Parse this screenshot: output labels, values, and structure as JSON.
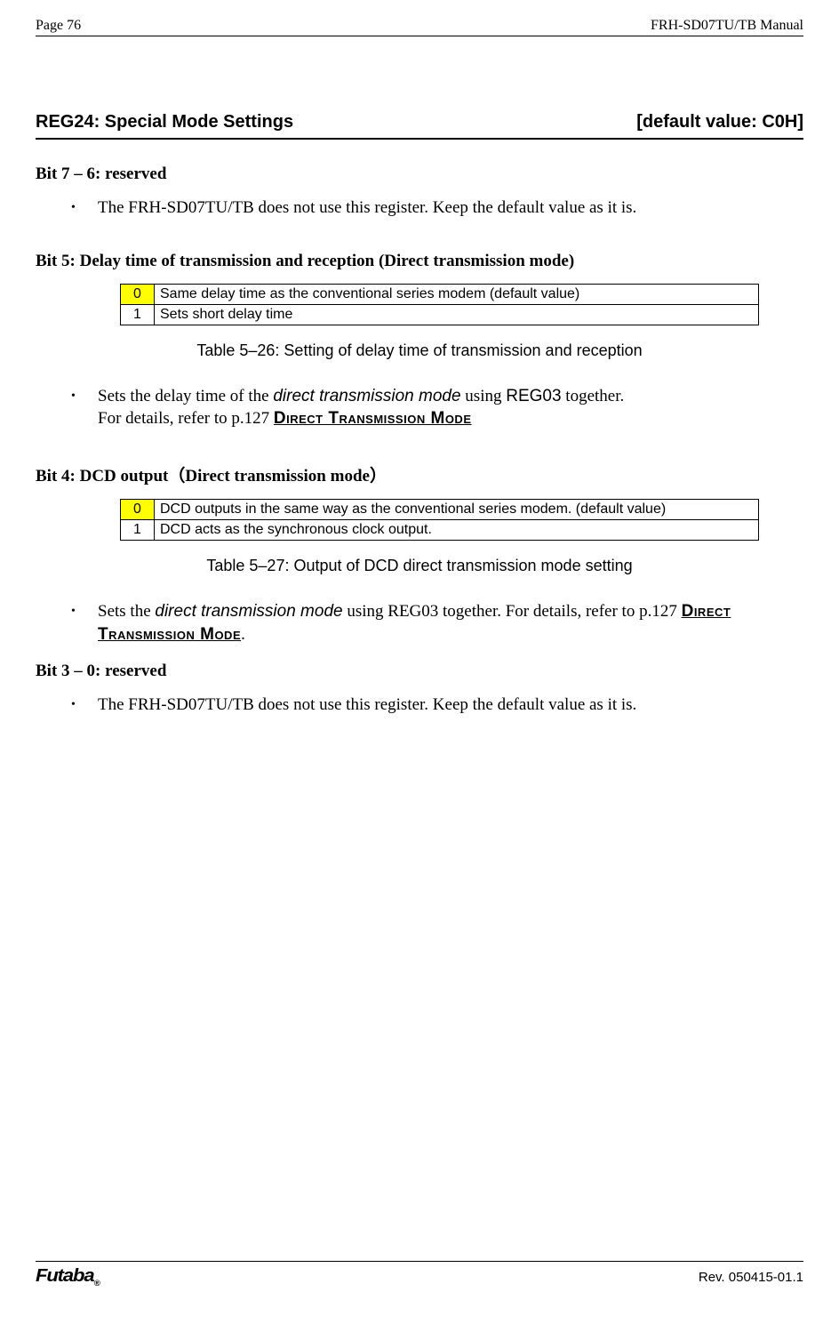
{
  "header": {
    "page_label": "Page  76",
    "manual_title": "FRH-SD07TU/TB Manual"
  },
  "title": {
    "left": "REG24:  Special Mode Settings",
    "right": "[default value: C0H]"
  },
  "bit76": {
    "heading": "Bit 7 – 6:  reserved",
    "bullet": "The FRH-SD07TU/TB does not use this register. Keep the default value as it is."
  },
  "bit5": {
    "heading": "Bit 5:  Delay time of transmission and reception (Direct transmission mode)",
    "rows": [
      {
        "val": "0",
        "highlight": true,
        "desc": "Same delay time as the conventional series modem (default value)"
      },
      {
        "val": "1",
        "highlight": false,
        "desc": "Sets short delay time"
      }
    ],
    "caption": "Table 5–26:  Setting of delay time of transmission and reception",
    "bullet_prefix": "Sets the delay time of the ",
    "bullet_italic": "direct transmission mode",
    "bullet_mid": " using ",
    "bullet_reg": "REG03",
    "bullet_after": " together.",
    "bullet_line2_prefix": "For details, refer to p.127 ",
    "bullet_link": "Direct Transmission Mode"
  },
  "bit4": {
    "heading": "Bit 4:  DCD output（Direct transmission mode）",
    "rows": [
      {
        "val": "0",
        "highlight": true,
        "desc": "DCD outputs in the same way as the conventional series modem. (default value)"
      },
      {
        "val": "1",
        "highlight": false,
        "desc": "DCD acts as the synchronous clock output."
      }
    ],
    "caption": "Table 5–27:  Output of DCD direct transmission mode setting",
    "bullet_prefix": "Sets the ",
    "bullet_italic": "direct transmission mode",
    "bullet_mid": " using REG03 together.  For details, refer to  p.127 ",
    "bullet_link": "Direct Transmission Mode",
    "bullet_after": "."
  },
  "bit30": {
    "heading": "Bit 3 – 0:  reserved",
    "bullet": "The FRH-SD07TU/TB does not use this register. Keep the default value as it is."
  },
  "footer": {
    "brand": "Futaba",
    "rev": "Rev. 050415-01.1"
  }
}
